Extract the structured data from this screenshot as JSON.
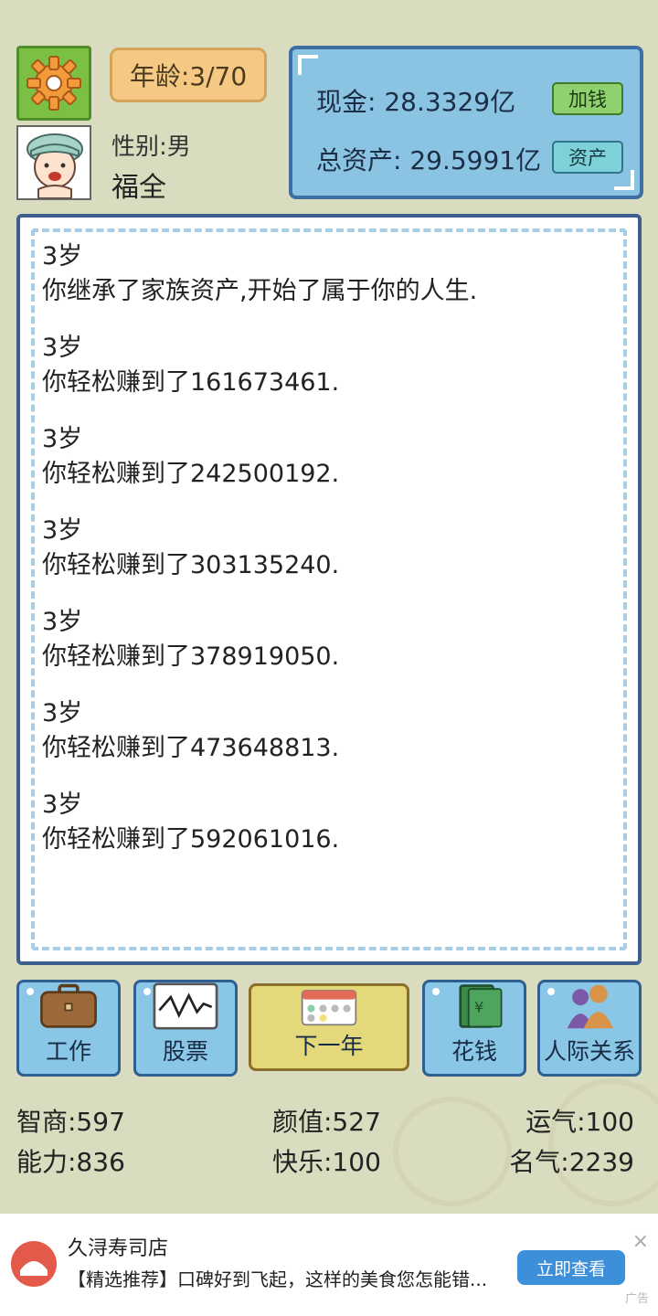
{
  "header": {
    "age_label": "年龄:3/70",
    "gender_label": "性别:男",
    "player_name": "福全"
  },
  "money": {
    "cash_label": "现金: 28.3329亿",
    "total_assets_label": "总资产: 29.5991亿",
    "add_money_button": "加钱",
    "assets_button": "资产"
  },
  "log": [
    {
      "age": "3岁",
      "text": "你继承了家族资产,开始了属于你的人生."
    },
    {
      "age": "3岁",
      "text": "你轻松赚到了161673461."
    },
    {
      "age": "3岁",
      "text": "你轻松赚到了242500192."
    },
    {
      "age": "3岁",
      "text": "你轻松赚到了303135240."
    },
    {
      "age": "3岁",
      "text": "你轻松赚到了378919050."
    },
    {
      "age": "3岁",
      "text": "你轻松赚到了473648813."
    },
    {
      "age": "3岁",
      "text": "你轻松赚到了592061016."
    }
  ],
  "actions": {
    "work": "工作",
    "stocks": "股票",
    "next_year": "下一年",
    "spend": "花钱",
    "relations": "人际关系"
  },
  "stats": {
    "iq": "智商:597",
    "looks": "颜值:527",
    "luck": "运气:100",
    "ability": "能力:836",
    "happiness": "快乐:100",
    "fame": "名气:2239"
  },
  "ad": {
    "title": "久浔寿司店",
    "description": "【精选推荐】口碑好到飞起，这样的美食您怎能错...",
    "cta": "立即查看",
    "tag": "广告",
    "close": "×"
  },
  "colors": {
    "background": "#d9dcbf",
    "money_panel": "#8bc3e3",
    "action_button": "#8ac6e5",
    "next_year_button": "#e3d97a",
    "ad_button": "#3d8fd9"
  }
}
